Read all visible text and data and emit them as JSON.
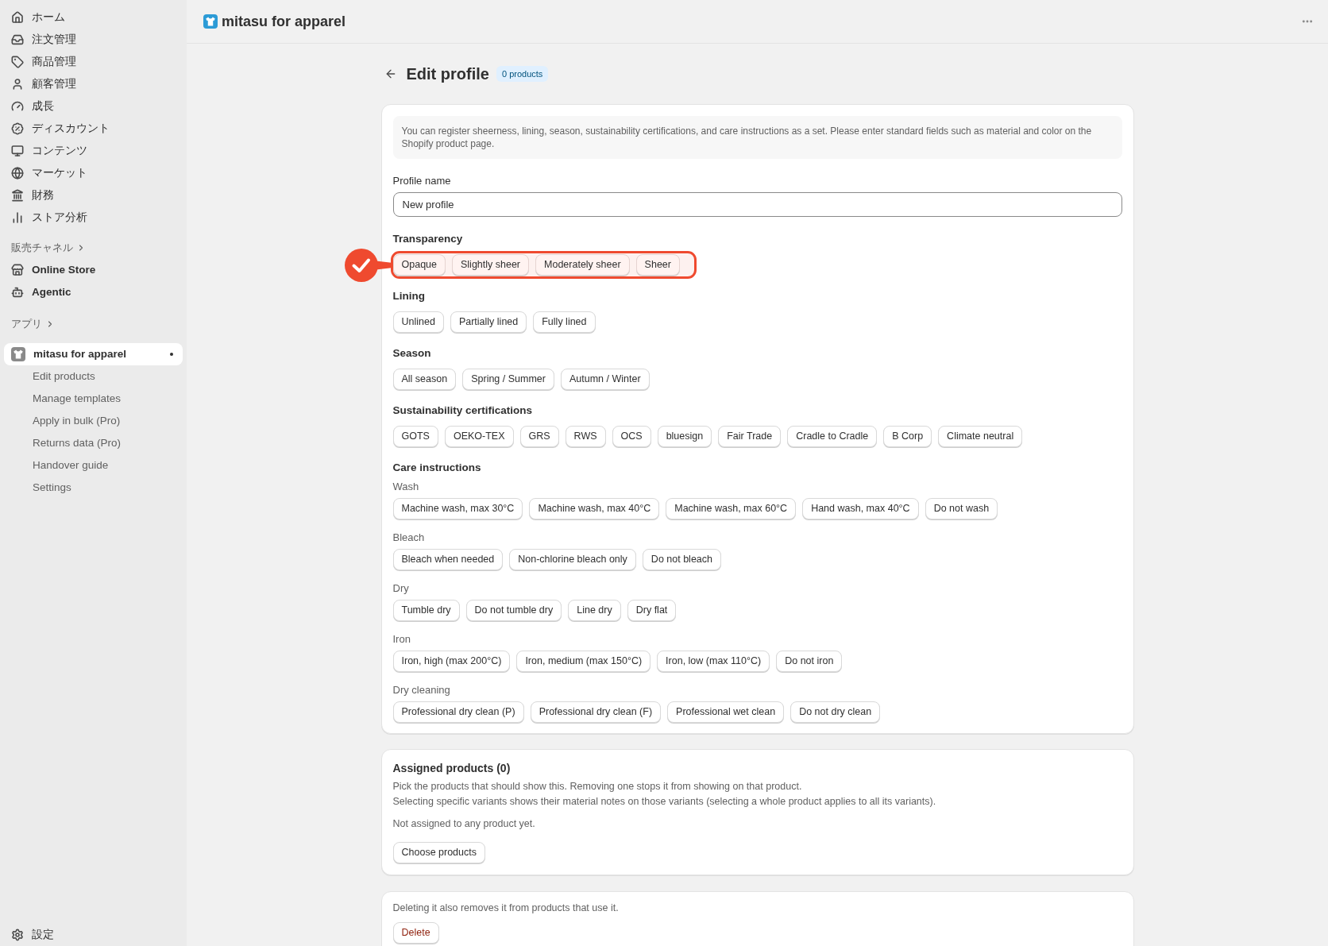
{
  "sidebar": {
    "nav": [
      {
        "label": "ホーム",
        "selected": false
      },
      {
        "label": "注文管理",
        "selected": false
      },
      {
        "label": "商品管理",
        "selected": false
      },
      {
        "label": "顧客管理",
        "selected": false
      },
      {
        "label": "成長",
        "selected": false
      },
      {
        "label": "ディスカウント",
        "selected": false
      },
      {
        "label": "コンテンツ",
        "selected": false
      },
      {
        "label": "マーケット",
        "selected": false
      },
      {
        "label": "財務",
        "selected": false
      },
      {
        "label": "ストア分析",
        "selected": false
      }
    ],
    "sales_channels": {
      "heading": "販売チャネル",
      "items": [
        {
          "label": "Online Store",
          "selected": false
        },
        {
          "label": "Agentic",
          "selected": false
        }
      ]
    },
    "apps": {
      "heading": "アプリ",
      "items": [
        {
          "label": "mitasu for apparel",
          "selected": true,
          "children": [
            {
              "label": "Edit products",
              "selected": false
            },
            {
              "label": "Manage templates",
              "selected": false
            },
            {
              "label": "Apply in bulk (Pro)",
              "selected": false
            },
            {
              "label": "Returns data (Pro)",
              "selected": false
            },
            {
              "label": "Handover guide",
              "selected": false
            },
            {
              "label": "Settings",
              "selected": false
            }
          ]
        }
      ]
    },
    "settings": {
      "label": "設定",
      "selected": false
    }
  },
  "header": {
    "app_name": "mitasu for apparel"
  },
  "page": {
    "title": "Edit profile",
    "badge": "0 products"
  },
  "profile_card": {
    "notice": "You can register sheerness, lining, season, sustainability certifications, and care instructions as a set. Please enter standard fields such as material and color on the Shopify product page.",
    "profile_name": {
      "label": "Profile name",
      "value": "New profile"
    },
    "groups": [
      {
        "title": "Transparency",
        "highlighted": true,
        "options": [
          {
            "label": "Opaque",
            "selected": false
          },
          {
            "label": "Slightly sheer",
            "selected": false
          },
          {
            "label": "Moderately sheer",
            "selected": false
          },
          {
            "label": "Sheer",
            "selected": false
          }
        ]
      },
      {
        "title": "Lining",
        "highlighted": false,
        "options": [
          {
            "label": "Unlined",
            "selected": false
          },
          {
            "label": "Partially lined",
            "selected": false
          },
          {
            "label": "Fully lined",
            "selected": false
          }
        ]
      },
      {
        "title": "Season",
        "highlighted": false,
        "options": [
          {
            "label": "All season",
            "selected": false
          },
          {
            "label": "Spring / Summer",
            "selected": false
          },
          {
            "label": "Autumn / Winter",
            "selected": false
          }
        ]
      },
      {
        "title": "Sustainability certifications",
        "highlighted": false,
        "options": [
          {
            "label": "GOTS",
            "selected": false
          },
          {
            "label": "OEKO-TEX",
            "selected": false
          },
          {
            "label": "GRS",
            "selected": false
          },
          {
            "label": "RWS",
            "selected": false
          },
          {
            "label": "OCS",
            "selected": false
          },
          {
            "label": "bluesign",
            "selected": false
          },
          {
            "label": "Fair Trade",
            "selected": false
          },
          {
            "label": "Cradle to Cradle",
            "selected": false
          },
          {
            "label": "B Corp",
            "selected": false
          },
          {
            "label": "Climate neutral",
            "selected": false
          }
        ]
      },
      {
        "title": "Care instructions",
        "highlighted": false,
        "subgroups": [
          {
            "title": "Wash",
            "options": [
              {
                "label": "Machine wash, max 30°C",
                "selected": false
              },
              {
                "label": "Machine wash, max 40°C",
                "selected": false
              },
              {
                "label": "Machine wash, max 60°C",
                "selected": false
              },
              {
                "label": "Hand wash, max 40°C",
                "selected": false
              },
              {
                "label": "Do not wash",
                "selected": false
              }
            ]
          },
          {
            "title": "Bleach",
            "options": [
              {
                "label": "Bleach when needed",
                "selected": false
              },
              {
                "label": "Non-chlorine bleach only",
                "selected": false
              },
              {
                "label": "Do not bleach",
                "selected": false
              }
            ]
          },
          {
            "title": "Dry",
            "options": [
              {
                "label": "Tumble dry",
                "selected": false
              },
              {
                "label": "Do not tumble dry",
                "selected": false
              },
              {
                "label": "Line dry",
                "selected": false
              },
              {
                "label": "Dry flat",
                "selected": false
              }
            ]
          },
          {
            "title": "Iron",
            "options": [
              {
                "label": "Iron, high (max 200°C)",
                "selected": false
              },
              {
                "label": "Iron, medium (max 150°C)",
                "selected": false
              },
              {
                "label": "Iron, low (max 110°C)",
                "selected": false
              },
              {
                "label": "Do not iron",
                "selected": false
              }
            ]
          },
          {
            "title": "Dry cleaning",
            "options": [
              {
                "label": "Professional dry clean (P)",
                "selected": false
              },
              {
                "label": "Professional dry clean (F)",
                "selected": false
              },
              {
                "label": "Professional wet clean",
                "selected": false
              },
              {
                "label": "Do not dry clean",
                "selected": false
              }
            ]
          }
        ]
      }
    ]
  },
  "assigned_card": {
    "title": "Assigned products (0)",
    "description": [
      "Pick the products that should show this. Removing one stops it from showing on that product.",
      "Selecting specific variants shows their material notes on those variants (selecting a whole product applies to all its variants)."
    ],
    "empty_text": "Not assigned to any product yet.",
    "button": "Choose products"
  },
  "delete_card": {
    "text": "Deleting it also removes it from products that use it.",
    "button": "Delete"
  }
}
